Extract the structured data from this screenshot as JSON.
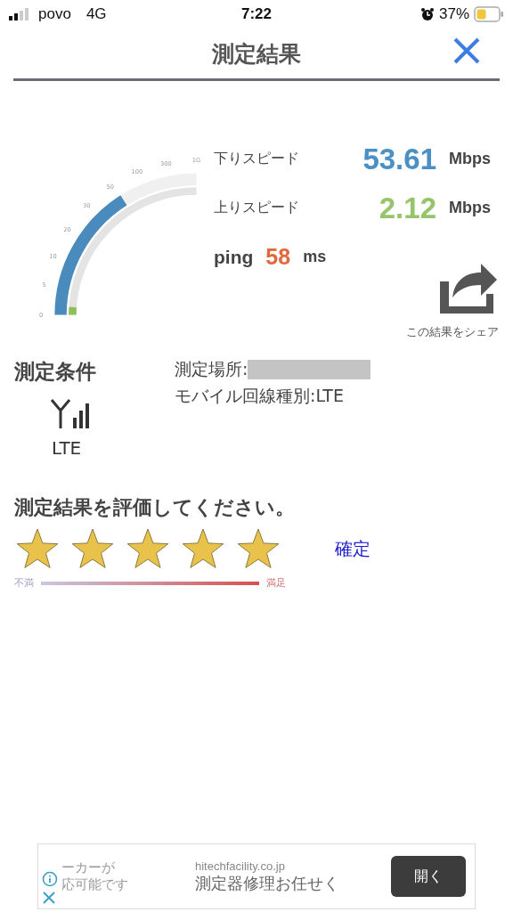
{
  "status_bar": {
    "carrier": "povo",
    "network": "4G",
    "time": "7:22",
    "battery_percent": "37%"
  },
  "header": {
    "title": "測定結果"
  },
  "gauge": {
    "ticks": [
      "0",
      "5",
      "10",
      "20",
      "30",
      "50",
      "100",
      "300",
      "1G"
    ]
  },
  "results": [
    {
      "kind": "speed",
      "label": "下りスピード",
      "value": "53.61",
      "unit": "Mbps",
      "color": "#4a90c4"
    },
    {
      "kind": "speed",
      "label": "上りスピード",
      "value": "2.12",
      "unit": "Mbps",
      "color": "#96c46a"
    },
    {
      "kind": "ping",
      "label": "ping",
      "value": "58",
      "unit": "ms",
      "color": "#e0683a"
    }
  ],
  "share": {
    "label": "この結果をシェア"
  },
  "conditions": {
    "title": "測定条件",
    "network_type": "LTE",
    "place_label": "測定場所:",
    "line_type": "モバイル回線種別:LTE"
  },
  "rating": {
    "prompt": "測定結果を評価してください。",
    "stars": 5,
    "confirm": "確定",
    "low_label": "不満",
    "high_label": "満足"
  },
  "ad": {
    "left_line_1": "ーカーが",
    "left_line_2": "応可能です",
    "domain": "hitechfacility.co.jp",
    "headline": "測定器修理お任せく",
    "button": "開く"
  }
}
